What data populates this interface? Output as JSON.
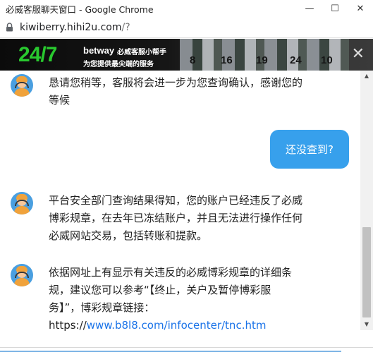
{
  "window": {
    "title": "必威客服聊天窗口 - Google Chrome",
    "minimize_glyph": "—",
    "maximize_glyph": "☐",
    "close_glyph": "✕"
  },
  "address": {
    "host": "kiwiberry.hihi2u.com",
    "path": "/?"
  },
  "banner": {
    "big_text": "24/7",
    "brand": "betway",
    "slogan_line1": "必威客服小帮手",
    "slogan_line2": "为您提供最尖端的服务",
    "jersey_numbers": [
      "8",
      "16",
      "19",
      "24",
      "10"
    ],
    "close_glyph": "✕"
  },
  "chat": {
    "messages": [
      {
        "from": "agent",
        "lines": [
          "恳请您稍等，客服将会进一步为您查询确认，感谢您的",
          "等候"
        ]
      },
      {
        "from": "user",
        "text": "还没查到?"
      },
      {
        "from": "agent",
        "lines": [
          "平台安全部门查询结果得知，您的账户已经违反了必威",
          "博彩规章，在去年已冻结账户，并且无法进行操作任何",
          "必威网站交易，包括转账和提款。"
        ]
      },
      {
        "from": "agent",
        "lines": [
          "依据网址上有显示有关违反的必威博彩规章的详细条",
          "规，建议您可以参考“【终止，关户及暂停博彩服",
          "务】”，博彩规章链接："
        ],
        "link_prefix": "https://",
        "link_text": "www.b8l8.com/infocenter/tnc.htm"
      }
    ]
  },
  "scrollbar": {
    "up_glyph": "▲",
    "down_glyph": "▼"
  },
  "colors": {
    "bubble": "#37a0ec",
    "link": "#1a73e8",
    "banner_accent": "#29c92f"
  }
}
